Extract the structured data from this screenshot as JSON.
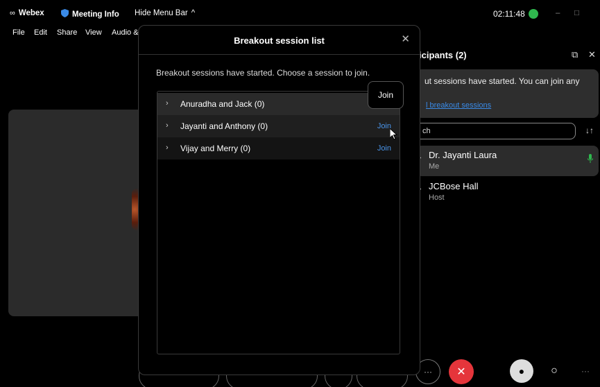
{
  "titlebar": {
    "app_name": "Webex",
    "meeting_info": "Meeting Info",
    "hide_menu_bar": "Hide Menu Bar",
    "clock": "02:11:48",
    "minimize": "–",
    "maximize": "□"
  },
  "menubar": {
    "file": "File",
    "edit": "Edit",
    "share": "Share",
    "view": "View",
    "audio": "Audio &"
  },
  "participants": {
    "title": "icipants (2)",
    "banner_text": "ut sessions have started. You can join any",
    "banner_link": "l breakout sessions",
    "search_value": "ch",
    "people": [
      {
        "name": "Dr. Jayanti Laura",
        "role": "Me"
      },
      {
        "name": "JCBose Hall",
        "role": "Host"
      }
    ]
  },
  "modal": {
    "title": "Breakout session list",
    "description": "Breakout sessions have started. Choose a session to join.",
    "tooltip": "Join",
    "sessions": [
      {
        "name": "Anuradha and Jack (0)",
        "join": ""
      },
      {
        "name": "Jayanti and Anthony (0)",
        "join": "Join"
      },
      {
        "name": "Vijay and Merry (0)",
        "join": "Join"
      }
    ]
  },
  "colors": {
    "link": "#4a95ea",
    "end_call": "#e5353b",
    "status_green": "#2fb84e"
  }
}
